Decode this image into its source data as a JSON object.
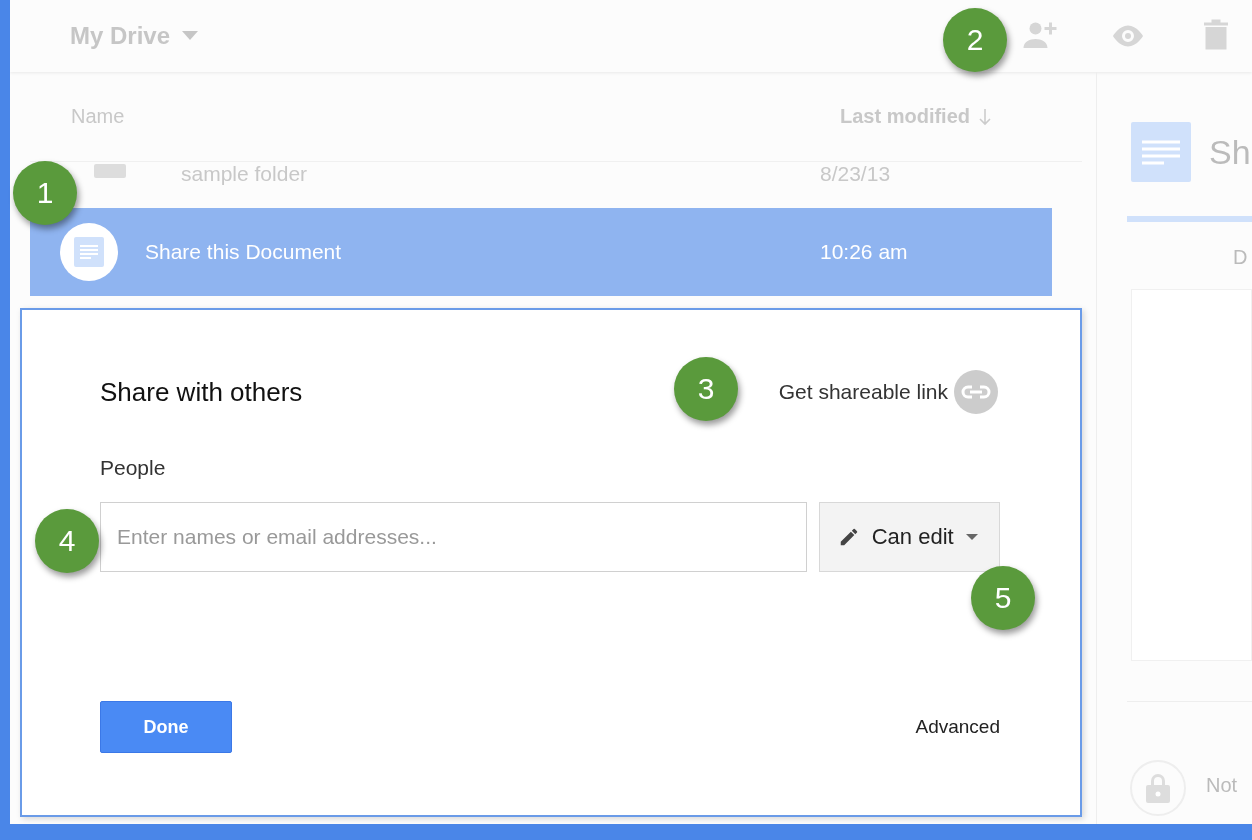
{
  "toolbar": {
    "title": "My Drive"
  },
  "file_list": {
    "columns": [
      "Name",
      "Last modified"
    ],
    "rows": [
      {
        "name": "sample folder",
        "modified": "8/23/13",
        "kind": "folder",
        "selected": false
      },
      {
        "name": "Share this Document",
        "modified": "10:26 am",
        "kind": "document",
        "selected": true
      }
    ]
  },
  "details_panel": {
    "title": "Sh",
    "tab": "D",
    "status": "Not"
  },
  "share_dialog": {
    "title": "Share with others",
    "link_label": "Get shareable link",
    "people_label": "People",
    "people_field": {
      "placeholder": "Enter names or email addresses..."
    },
    "permission": "Can edit",
    "done": "Done",
    "advanced": "Advanced"
  },
  "callouts": [
    "1",
    "2",
    "3",
    "4",
    "5"
  ]
}
